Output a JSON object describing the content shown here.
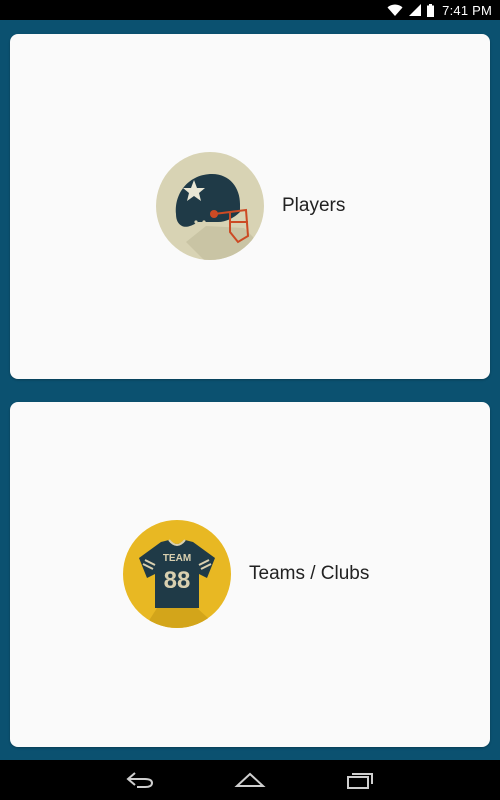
{
  "status_bar": {
    "time": "7:41 PM",
    "icons": [
      "wifi-icon",
      "signal-icon",
      "battery-icon"
    ]
  },
  "cards": [
    {
      "label": "Players",
      "icon": "helmet-icon",
      "icon_bg": "#d8d3b4"
    },
    {
      "label": "Teams / Clubs",
      "icon": "jersey-icon",
      "icon_bg": "#e8b823"
    }
  ],
  "jersey": {
    "text": "TEAM",
    "number": "88"
  },
  "nav_bar": {
    "buttons": [
      "back-icon",
      "home-icon",
      "recent-apps-icon"
    ]
  },
  "colors": {
    "app_background": "#0b5170",
    "card_background": "#fafafa",
    "icon_navy": "#1f3a47",
    "accent_orange": "#cc4a24"
  }
}
